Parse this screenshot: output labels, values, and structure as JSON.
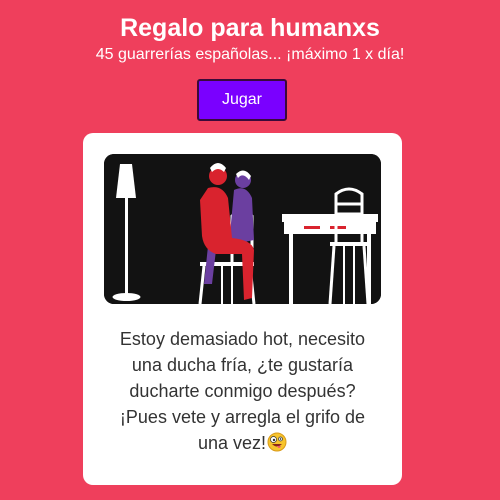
{
  "header": {
    "title": "Regalo para humanxs",
    "subtitle": "45 guarrerías españolas... ¡máximo 1 x día!"
  },
  "play_button": {
    "label": "Jugar"
  },
  "card": {
    "illustration": {
      "icon": "couple-on-chair-illustration"
    },
    "message_lines": [
      "Estoy demasiado hot, necesito",
      "una ducha fría, ¿te gustaría",
      "ducharte conmigo después?",
      "¡Pues vete y arregla el grifo de",
      "una vez!"
    ],
    "emoji": "zany-face-emoji"
  },
  "colors": {
    "background": "#ef3f5c",
    "button": "#7a00ff",
    "card": "#ffffff",
    "illustration_bg": "#121212",
    "figure_red": "#d9232e",
    "figure_purple": "#6b3fa0"
  }
}
